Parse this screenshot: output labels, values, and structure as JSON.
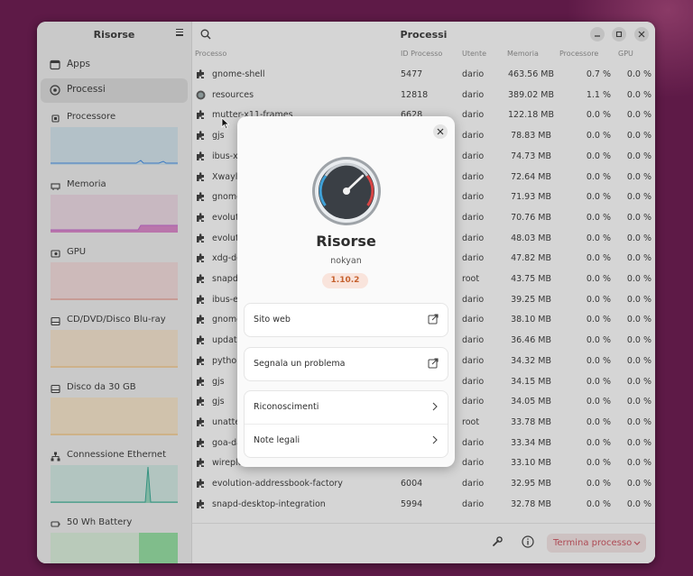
{
  "window_title": "Risorse",
  "sidebar": {
    "title": "Risorse",
    "nav": [
      {
        "label": "Apps",
        "icon": "apps-icon"
      },
      {
        "label": "Processi",
        "icon": "processes-icon",
        "active": true
      }
    ],
    "resources": [
      {
        "label": "Processore",
        "icon": "cpu-icon",
        "color": "#3584e4",
        "fill": "#cde0e8"
      },
      {
        "label": "Memoria",
        "icon": "memory-icon",
        "color": "#c061cb",
        "fill": "#ead6e2"
      },
      {
        "label": "GPU",
        "icon": "gpu-icon",
        "color": "#e66100",
        "fill": "#f0d9d9"
      },
      {
        "label": "CD/DVD/Disco Blu-ray",
        "icon": "disc-drive-icon",
        "color": "#f5c211",
        "fill": "#f3e1cb"
      },
      {
        "label": "Disco da 30 GB",
        "icon": "disk-icon",
        "color": "#f5c211",
        "fill": "#f4e3c8"
      },
      {
        "label": "Connessione Ethernet",
        "icon": "network-icon",
        "color": "#2ec27e",
        "fill": "#cde7e0"
      },
      {
        "label": "50 Wh Battery",
        "icon": "battery-icon",
        "color": "#33d17a",
        "fill": "#d4ebd8"
      }
    ]
  },
  "main": {
    "title": "Processi",
    "columns": [
      "Processo",
      "ID Processo",
      "Utente",
      "Memoria",
      "Processore",
      "GPU"
    ],
    "rows": [
      {
        "name": "gnome-shell",
        "pid": "5477",
        "user": "dario",
        "mem": "463.56 MB",
        "cpu": "0.7 %",
        "gpu": "0.0 %"
      },
      {
        "name": "resources",
        "pid": "12818",
        "user": "dario",
        "mem": "389.02 MB",
        "cpu": "1.1 %",
        "gpu": "0.0 %"
      },
      {
        "name": "mutter-x11-frames",
        "pid": "6628",
        "user": "dario",
        "mem": "122.18 MB",
        "cpu": "0.0 %",
        "gpu": "0.0 %"
      },
      {
        "name": "gjs",
        "pid": "",
        "user": "dario",
        "mem": "78.83 MB",
        "cpu": "0.0 %",
        "gpu": "0.0 %"
      },
      {
        "name": "ibus-x11",
        "pid": "",
        "user": "dario",
        "mem": "74.73 MB",
        "cpu": "0.0 %",
        "gpu": "0.0 %"
      },
      {
        "name": "Xwayland",
        "pid": "",
        "user": "dario",
        "mem": "72.64 MB",
        "cpu": "0.0 %",
        "gpu": "0.0 %"
      },
      {
        "name": "gnome-",
        "pid": "",
        "user": "dario",
        "mem": "71.93 MB",
        "cpu": "0.0 %",
        "gpu": "0.0 %"
      },
      {
        "name": "evolution-",
        "pid": "",
        "user": "dario",
        "mem": "70.76 MB",
        "cpu": "0.0 %",
        "gpu": "0.0 %"
      },
      {
        "name": "evolution-",
        "pid": "",
        "user": "dario",
        "mem": "48.03 MB",
        "cpu": "0.0 %",
        "gpu": "0.0 %"
      },
      {
        "name": "xdg-desktop-",
        "pid": "",
        "user": "dario",
        "mem": "47.82 MB",
        "cpu": "0.0 %",
        "gpu": "0.0 %"
      },
      {
        "name": "snapd",
        "pid": "",
        "user": "root",
        "mem": "43.75 MB",
        "cpu": "0.0 %",
        "gpu": "0.0 %"
      },
      {
        "name": "ibus-ex",
        "pid": "",
        "user": "dario",
        "mem": "39.25 MB",
        "cpu": "0.0 %",
        "gpu": "0.0 %"
      },
      {
        "name": "gnome-",
        "pid": "",
        "user": "dario",
        "mem": "38.10 MB",
        "cpu": "0.0 %",
        "gpu": "0.0 %"
      },
      {
        "name": "update-",
        "pid": "",
        "user": "dario",
        "mem": "36.46 MB",
        "cpu": "0.0 %",
        "gpu": "0.0 %"
      },
      {
        "name": "python",
        "pid": "",
        "user": "dario",
        "mem": "34.32 MB",
        "cpu": "0.0 %",
        "gpu": "0.0 %"
      },
      {
        "name": "gjs",
        "pid": "",
        "user": "dario",
        "mem": "34.15 MB",
        "cpu": "0.0 %",
        "gpu": "0.0 %"
      },
      {
        "name": "gjs",
        "pid": "",
        "user": "dario",
        "mem": "34.05 MB",
        "cpu": "0.0 %",
        "gpu": "0.0 %"
      },
      {
        "name": "unatte",
        "pid": "",
        "user": "root",
        "mem": "33.78 MB",
        "cpu": "0.0 %",
        "gpu": "0.0 %"
      },
      {
        "name": "goa-da",
        "pid": "",
        "user": "dario",
        "mem": "33.34 MB",
        "cpu": "0.0 %",
        "gpu": "0.0 %"
      },
      {
        "name": "wireplumber",
        "pid": "5469",
        "user": "dario",
        "mem": "33.10 MB",
        "cpu": "0.0 %",
        "gpu": "0.0 %"
      },
      {
        "name": "evolution-addressbook-factory",
        "pid": "6004",
        "user": "dario",
        "mem": "32.95 MB",
        "cpu": "0.0 %",
        "gpu": "0.0 %"
      },
      {
        "name": "snapd-desktop-integration",
        "pid": "5994",
        "user": "dario",
        "mem": "32.78 MB",
        "cpu": "0.0 %",
        "gpu": "0.0 %"
      }
    ],
    "kill_button": "Termina processo"
  },
  "about": {
    "app_name": "Risorse",
    "developer": "nokyan",
    "version": "1.10.2",
    "links": [
      {
        "label": "Sito web"
      },
      {
        "label": "Segnala un problema"
      }
    ],
    "items": [
      {
        "label": "Riconoscimenti"
      },
      {
        "label": "Note legali"
      }
    ]
  }
}
